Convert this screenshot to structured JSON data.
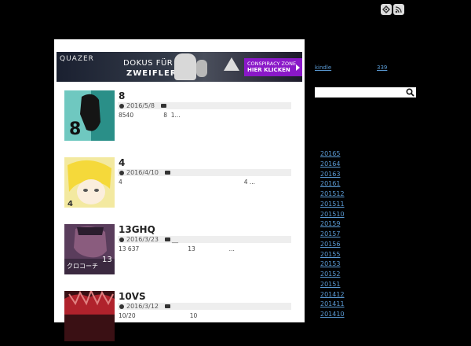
{
  "header": {
    "icons": [
      "feedly-icon",
      "rss-icon"
    ]
  },
  "ad": {
    "brand": "QUAZER",
    "headline_line1": "DOKUS FÜR",
    "headline_line2": "ZWEIFLER",
    "cta_line1": "CONSPIRACY ZONE",
    "cta_line2": "HIER KLICKEN"
  },
  "posts": [
    {
      "title": "8",
      "date": "2016/5/8",
      "category": "",
      "excerpt": "8540                8  1..."
    },
    {
      "title": "4",
      "date": "2016/4/10",
      "category": "",
      "excerpt": "4                                                                 4 ..."
    },
    {
      "title": "13GHQ",
      "date": "2016/3/23",
      "category": "__",
      "excerpt": "13 637                          13                  ..."
    },
    {
      "title": "10VS",
      "date": "2016/3/12",
      "category": "",
      "excerpt": "10/20                             10"
    }
  ],
  "sidebar": {
    "link_kindle": "kindle",
    "link_count": "339",
    "archives": [
      "20165",
      "20164",
      "20163",
      "20161",
      "201512",
      "201511",
      "201510",
      "20159",
      "20157",
      "20156",
      "20155",
      "20153",
      "20152",
      "20151",
      "201412",
      "201411",
      "201410"
    ]
  },
  "colors": {
    "background": "#000000",
    "link": "#5b9bd5",
    "cta": "#8a18c8"
  }
}
